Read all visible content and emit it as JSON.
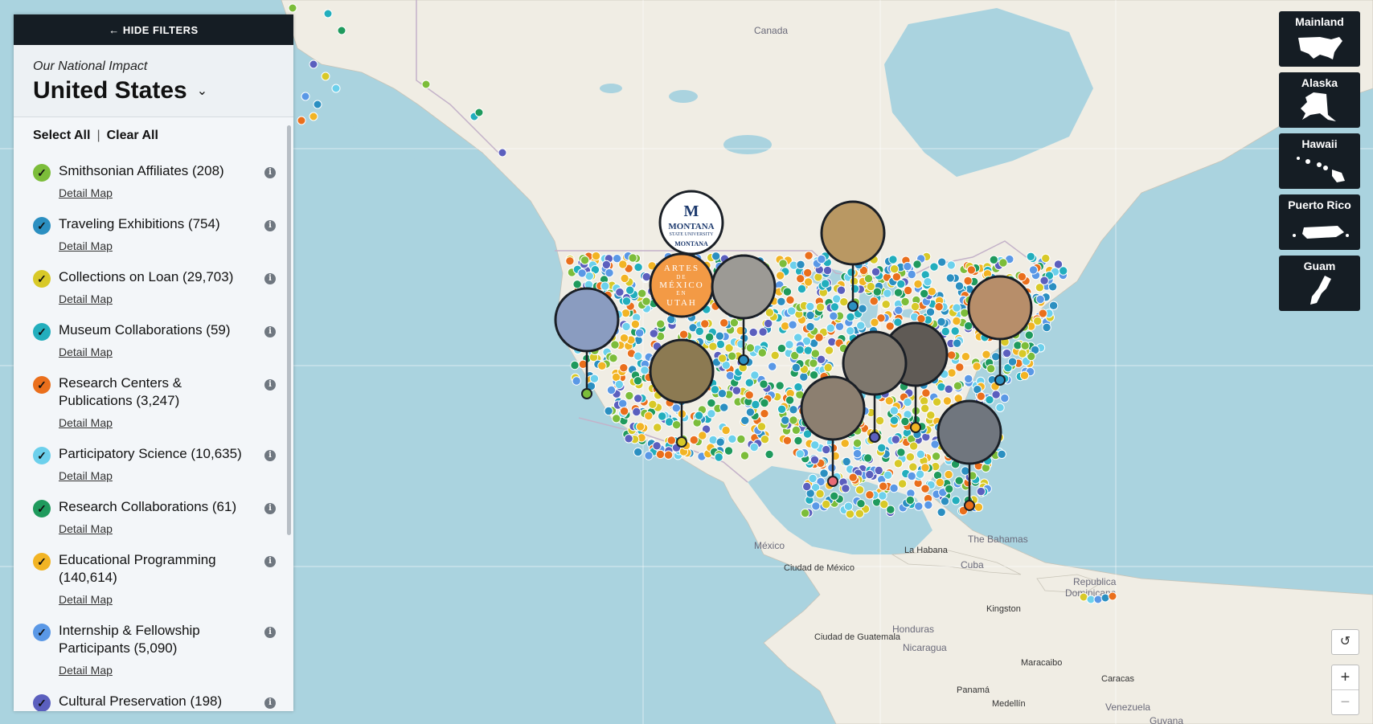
{
  "panel": {
    "hide_filters": "← HIDE FILTERS",
    "kicker": "Our National Impact",
    "country": "United States",
    "select_all": "Select All",
    "separator": "|",
    "clear_all": "Clear All",
    "detail_label": "Detail Map",
    "filters": [
      {
        "label": "Smithsonian Affiliates (208)",
        "color": "#7cbd3a"
      },
      {
        "label": "Traveling Exhibitions (754)",
        "color": "#2b8fc1"
      },
      {
        "label": "Collections on Loan (29,703)",
        "color": "#d8c928"
      },
      {
        "label": "Museum Collaborations (59)",
        "color": "#22aebd"
      },
      {
        "label": "Research Centers & Publications (3,247)",
        "color": "#ea6f1c"
      },
      {
        "label": "Participatory Science (10,635)",
        "color": "#6cd0ec"
      },
      {
        "label": "Research Collaborations (61)",
        "color": "#1f9a5d"
      },
      {
        "label": "Educational Programming (140,614)",
        "color": "#f2b424"
      },
      {
        "label": "Internship & Fellowship Participants (5,090)",
        "color": "#5a98e6"
      },
      {
        "label": "Cultural Preservation (198)",
        "color": "#5b5fbe"
      }
    ]
  },
  "regions": [
    "Mainland",
    "Alaska",
    "Hawaii",
    "Puerto Rico",
    "Guam"
  ],
  "controls": {
    "reset": "↺",
    "zoom_in": "+",
    "zoom_out": "−"
  },
  "map_labels": {
    "canada": "Canada",
    "mexico": "México",
    "mexico_city": "Ciudad de México",
    "guatemala": "Ciudad de Guatemala",
    "honduras": "Honduras",
    "nicaragua": "Nicaragua",
    "la_habana": "La Habana",
    "cuba": "Cuba",
    "bahamas": "The Bahamas",
    "kingston": "Kingston",
    "republica": "Republica",
    "dominicana": "Dominicana",
    "maracaibo": "Maracaibo",
    "caracas": "Caracas",
    "panama": "Panamá",
    "medellin": "Medellín",
    "venezuela": "Venezuela",
    "guyana": "Guyana",
    "montana": "MONTANA",
    "montana_sub": "STATE UNIVERSITY",
    "montana_sub2": "MONTANA",
    "artes1": "ARTES",
    "artes2": "DE",
    "artes3": "MÉXICO",
    "artes4": "EN",
    "artes5": "UTAH"
  }
}
